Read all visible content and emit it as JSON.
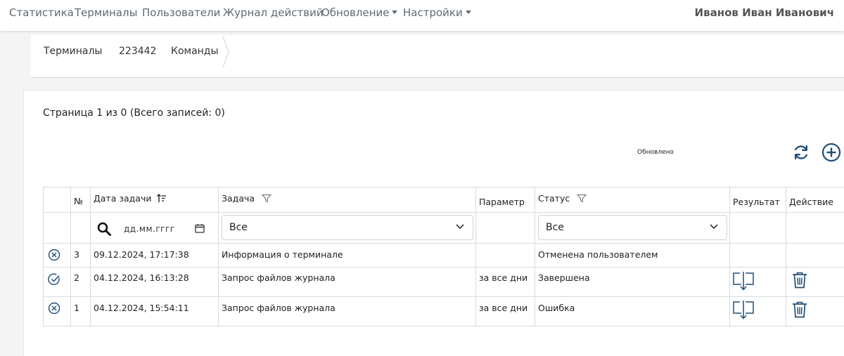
{
  "nav": {
    "items": [
      "Статистика",
      "Терминалы",
      "Пользователи",
      "Журнал действий",
      "Обновление",
      "Настройки"
    ],
    "user": "Иванов Иван Иванович"
  },
  "breadcrumb": [
    "Терминалы",
    "223442",
    "Команды"
  ],
  "page_info": "Страница 1 из 0 (Всего записей: 0)",
  "updated_label": "Обновлено",
  "table": {
    "headers": {
      "number": "№",
      "date": "Дата задачи",
      "task": "Задача",
      "param": "Параметр",
      "status": "Статус",
      "result": "Результат",
      "action": "Действие"
    },
    "filters": {
      "date_placeholder": "дд.мм.гггг",
      "task_select": "Все",
      "status_select": "Все"
    },
    "rows": [
      {
        "state_icon": "cancel-circle-icon",
        "num": "3",
        "date": "09.12.2024, 17:17:38",
        "task": "Информация о терминале",
        "param": "",
        "status": "Отменена пользователем",
        "has_result": false,
        "has_delete": false
      },
      {
        "state_icon": "check-circle-icon",
        "num": "2",
        "date": "04.12.2024, 16:13:28",
        "task": "Запрос файлов журнала",
        "param": "за все дни",
        "status": "Завершена",
        "has_result": true,
        "has_delete": true
      },
      {
        "state_icon": "cancel-circle-icon",
        "num": "1",
        "date": "04.12.2024, 15:54:11",
        "task": "Запрос файлов журнала",
        "param": "за все дни",
        "status": "Ошибка",
        "has_result": true,
        "has_delete": true
      }
    ]
  },
  "colors": {
    "accent": "#1f4e79",
    "nav_text": "#5f6a72",
    "border": "#d7dadd"
  }
}
